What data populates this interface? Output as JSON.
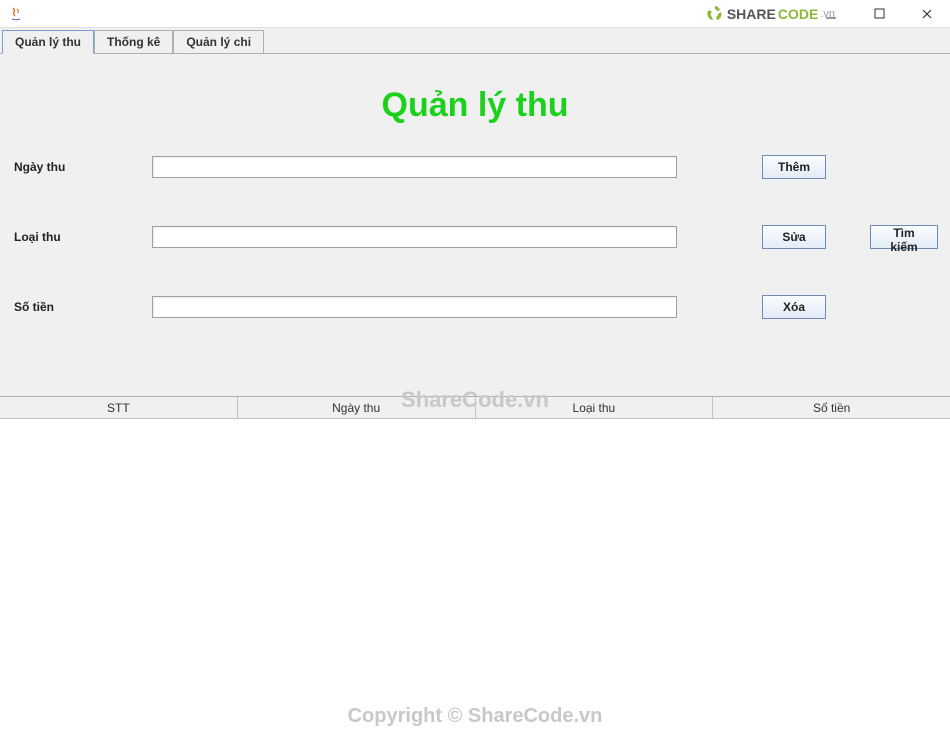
{
  "window": {
    "title": ""
  },
  "tabs": [
    {
      "label": "Quản lý thu",
      "active": true
    },
    {
      "label": "Thống kê",
      "active": false
    },
    {
      "label": "Quản lý chi",
      "active": false
    }
  ],
  "page": {
    "title": "Quản lý thu"
  },
  "form": {
    "ngay_thu_label": "Ngày thu",
    "ngay_thu_value": "",
    "loai_thu_label": "Loại thu",
    "loai_thu_value": "",
    "so_tien_label": "Số tiền",
    "so_tien_value": ""
  },
  "buttons": {
    "them": "Thêm",
    "sua": "Sửa",
    "tim_kiem": "Tìm kiếm",
    "xoa": "Xóa"
  },
  "table": {
    "headers": [
      "STT",
      "Ngày thu",
      "Loại thu",
      "Số tiền"
    ],
    "rows": []
  },
  "watermarks": {
    "center": "ShareCode.vn",
    "bottom": "Copyright © ShareCode.vn",
    "logo_text1": "SHARE",
    "logo_text2": "CODE",
    "logo_suffix": ".vn"
  }
}
